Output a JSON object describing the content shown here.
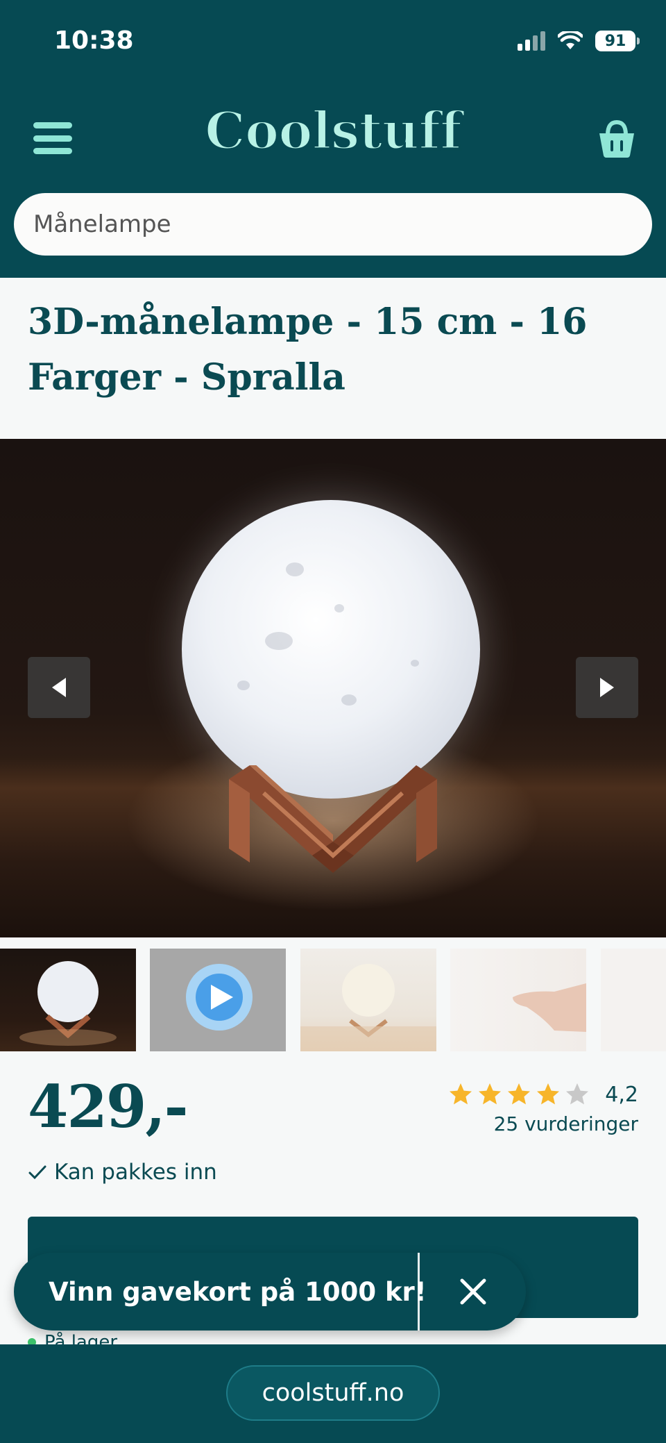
{
  "status_bar": {
    "time": "10:38",
    "battery": "91"
  },
  "header": {
    "logo": "Coolstuff",
    "search_value": "Månelampe"
  },
  "product": {
    "title": "3D-månelampe - 15 cm - 16 Farger - Spralla",
    "price": "429,-",
    "rating": {
      "value": "4,2",
      "stars_filled": 4,
      "stars_total": 5,
      "reviews": "25 vurderinger"
    },
    "gift_wrap": "Kan pakkes inn",
    "stock": "På lager"
  },
  "promo": {
    "text": "Vinn gavekort på 1000 kr!"
  },
  "browser": {
    "url": "coolstuff.no"
  },
  "colors": {
    "brand": "#064a53",
    "accent": "#8fe6d6",
    "star": "#f7b52a",
    "star_empty": "#c8c8c8",
    "stock_dot": "#3cc16b"
  }
}
